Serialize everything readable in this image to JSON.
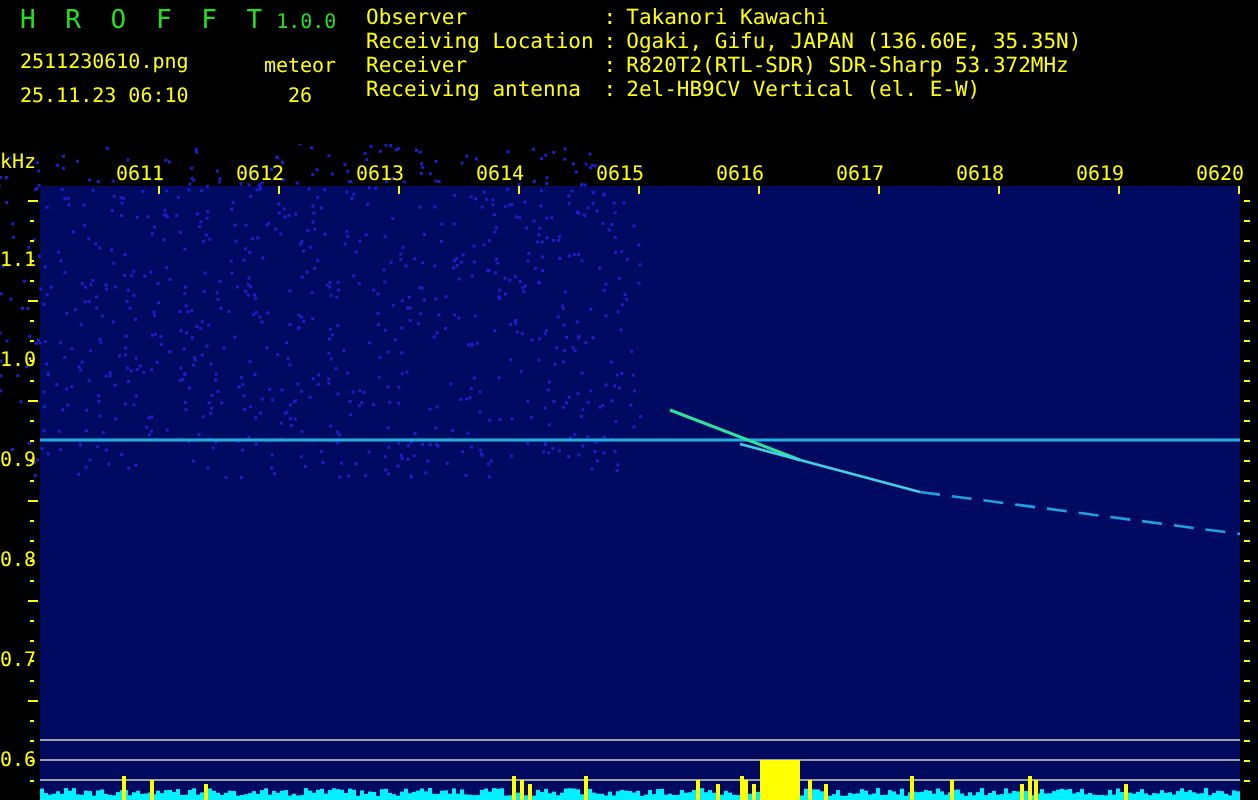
{
  "header": {
    "app_name": "H R O F F T",
    "version": "1.0.0",
    "filename": "2511230610.png",
    "datetime": "25.11.23 06:10",
    "meteor_label": "meteor",
    "meteor_count": "26"
  },
  "station_info": [
    {
      "label": "Observer",
      "separator": ":",
      "value": "Takanori Kawachi"
    },
    {
      "label": "Receiving Location",
      "separator": ":",
      "value": "Ogaki, Gifu, JAPAN (136.60E, 35.35N)"
    },
    {
      "label": "Receiver",
      "separator": ":",
      "value": "R820T2(RTL-SDR) SDR-Sharp 53.372MHz"
    },
    {
      "label": "Receiving antenna",
      "separator": ":",
      "value": "2el-HB9CV Vertical (el. E-W)"
    }
  ],
  "spectrogram": {
    "unit": "kHz",
    "time_labels": [
      "0611",
      "0612",
      "0613",
      "0614",
      "0615",
      "0616",
      "0617",
      "0618",
      "0619",
      "0620"
    ],
    "frequency_labels": [
      "1.1",
      "1.0",
      "0.9",
      "0.8",
      "0.7",
      "0.6"
    ]
  }
}
